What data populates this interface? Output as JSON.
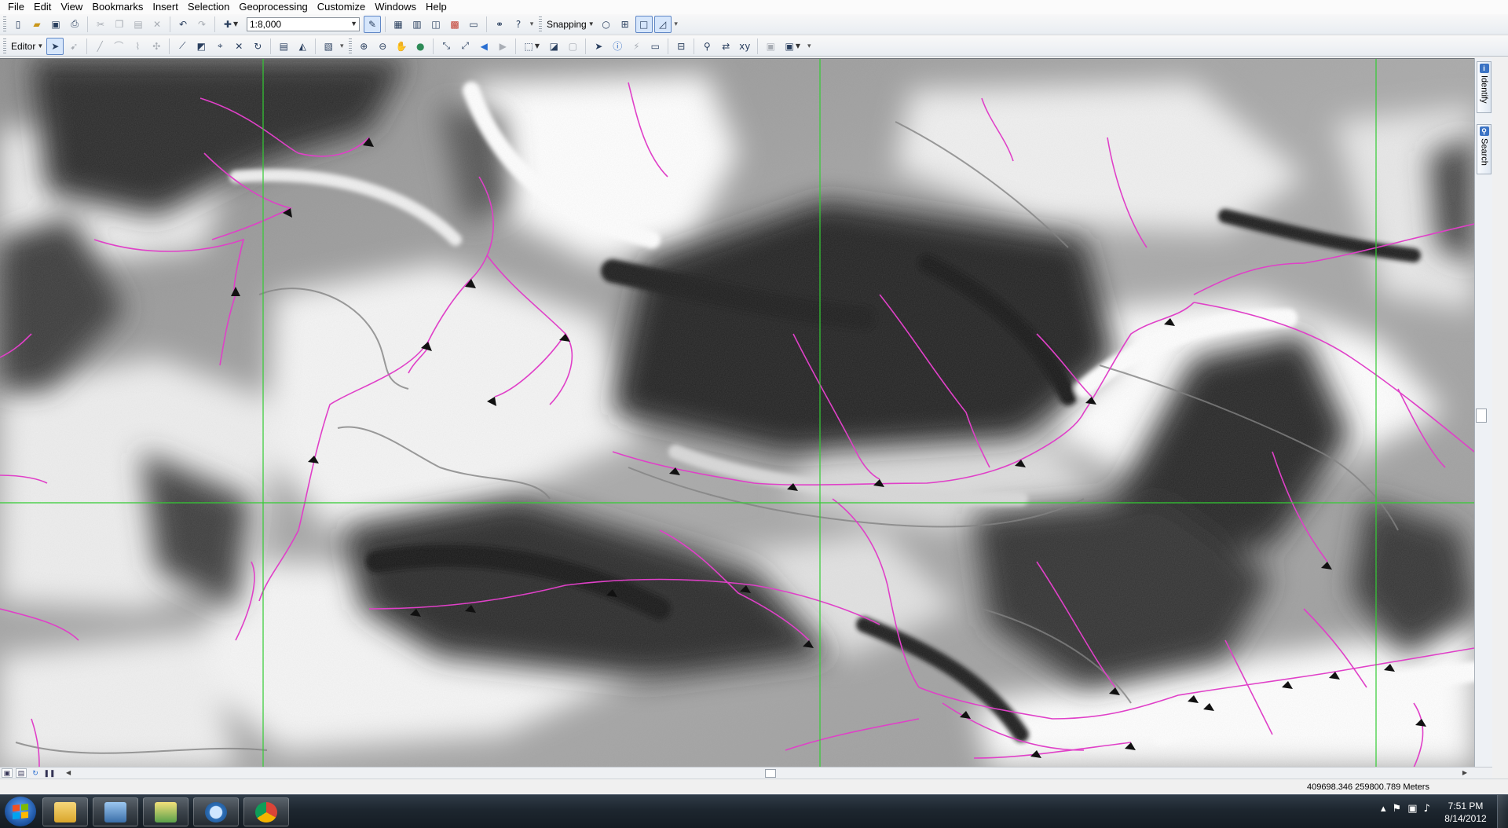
{
  "menu": {
    "items": [
      "File",
      "Edit",
      "View",
      "Bookmarks",
      "Insert",
      "Selection",
      "Geoprocessing",
      "Customize",
      "Windows",
      "Help"
    ]
  },
  "toolbar": {
    "scale_value": "1:8,000",
    "snapping_label": "Snapping",
    "editor_label": "Editor"
  },
  "dock": {
    "identify_label": "Identify",
    "search_label": "Search"
  },
  "status": {
    "coordinates": "409698.346  259800.789 Meters"
  },
  "taskbar": {
    "time": "7:51 PM",
    "date": "8/14/2012",
    "apps": [
      "windows-explorer",
      "computer-management",
      "arcgis",
      "magnifier",
      "chrome"
    ]
  },
  "map": {
    "graticule_color": "#33cc33",
    "stream_color": "#e040c8",
    "arrow_color": "#111111"
  }
}
